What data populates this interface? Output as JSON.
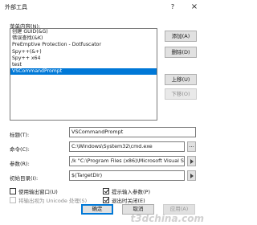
{
  "window": {
    "title": "外部工具",
    "help_label": "?",
    "close_label": "×"
  },
  "menu_contents_label": "菜单内容(N):",
  "tools": [
    "创建 GUID(&G)",
    "错误查找(&K)",
    "PreEmptive Protection - Dotfuscator",
    "Spy++(&+)",
    "Spy++ x64",
    "test",
    "VSCommandPrompt"
  ],
  "selected_index": 6,
  "buttons": {
    "add": "添加(A)",
    "delete": "删除(D)",
    "move_up": "上移(U)",
    "move_down": "下移(O)"
  },
  "fields": {
    "title_label": "标题(T):",
    "title_value": "VSCommandPrompt",
    "command_label": "命令(C):",
    "command_value": "C:\\Windows\\System32\\cmd.exe",
    "args_label": "参数(R):",
    "args_value": "/k \"C:\\Program Files (x86)\\Microsoft Visual S",
    "initdir_label": "初始目录(I):",
    "initdir_value": "$(TargetDir)",
    "browse_label": "..."
  },
  "checkboxes": {
    "use_output_window": {
      "label": "使用输出窗口(U)",
      "checked": false
    },
    "prompt_args": {
      "label": "提示输入参数(P)",
      "checked": true
    },
    "unicode_output": {
      "label": "将输出视为 Unicode 处理(S)",
      "checked": false
    },
    "close_on_exit": {
      "label": "退出时关闭(E)",
      "checked": true
    }
  },
  "footer": {
    "ok": "确定",
    "cancel": "取消",
    "apply": "应用(A)"
  },
  "watermark": "t3dchina.com"
}
